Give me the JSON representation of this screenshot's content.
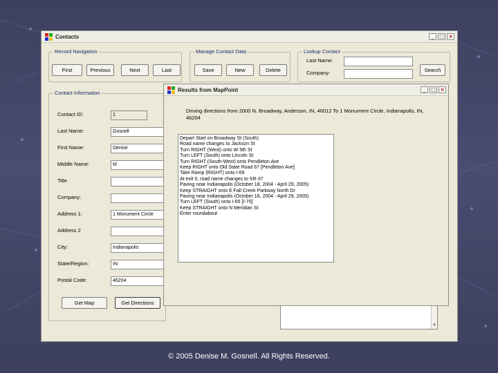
{
  "contacts_window": {
    "title": "Contacts",
    "record_navigation": {
      "label": "Record Navigation",
      "first": "First",
      "previous": "Previous",
      "next": "Next",
      "last": "Last"
    },
    "manage_contact_data": {
      "label": "Manage Contact Data",
      "save": "Save",
      "new": "New",
      "delete": "Delete"
    },
    "lookup_contact": {
      "label": "Lookup Contact",
      "last_name_label": "Last Name:",
      "last_name_value": "",
      "company_label": "Company:",
      "company_value": "",
      "search": "Search"
    },
    "contact_information": {
      "label": "Contact Information",
      "fields": [
        {
          "label": "Contact ID:",
          "value": "1"
        },
        {
          "label": "Last Name:",
          "value": "Gosnell"
        },
        {
          "label": "First Name:",
          "value": "Denise"
        },
        {
          "label": "Middle Name:",
          "value": "M"
        },
        {
          "label": "Title",
          "value": ""
        },
        {
          "label": "Company:",
          "value": ""
        },
        {
          "label": "Address 1:",
          "value": "1 Monument Circle"
        },
        {
          "label": "Address 2",
          "value": ""
        },
        {
          "label": "City:",
          "value": "Indianapolis"
        },
        {
          "label": "State/Region:",
          "value": "IN"
        },
        {
          "label": "Postal Code:",
          "value": "46204"
        }
      ],
      "get_map": "Get Map",
      "get_directions": "Get Directions"
    }
  },
  "mappoint_window": {
    "title": "Results from MapPoint",
    "summary": "Driving directions from 2000 N. Broadway, Anderson, IN, 46012 To 1 Monument Circle, Indianapolis, IN, 46204",
    "directions": [
      "Depart Start on Broadway St (South)",
      "Road name changes to Jackson St",
      "Turn RIGHT (West) onto W 5th St",
      "Turn LEFT (South) onto Lincoln St",
      "Turn RIGHT (South-West) onto Pendleton Ave",
      "Keep RIGHT onto Old State Road 67 [Pendleton Ave]",
      "Take Ramp (RIGHT) onto I-69",
      "At exit 0, road name changes to SR-37",
      "Paving near Indianapolis (October 18, 2004 - April 29, 2005)",
      "Keep STRAIGHT onto E Fall Creek Parkway North Dr",
      "Paving near Indianapolis (October 18, 2004 - April 29, 2005)",
      "Turn LEFT (South) onto I-65 [I-70]",
      "Keep STRAIGHT onto N Meridian St",
      "Enter roundabout"
    ]
  },
  "footer": "© 2005 Denise M. Gosnell.  All Rights Reserved.",
  "colors": {
    "background": "#44466a",
    "window": "#ece9d8",
    "group_label": "#1b2a6b"
  }
}
